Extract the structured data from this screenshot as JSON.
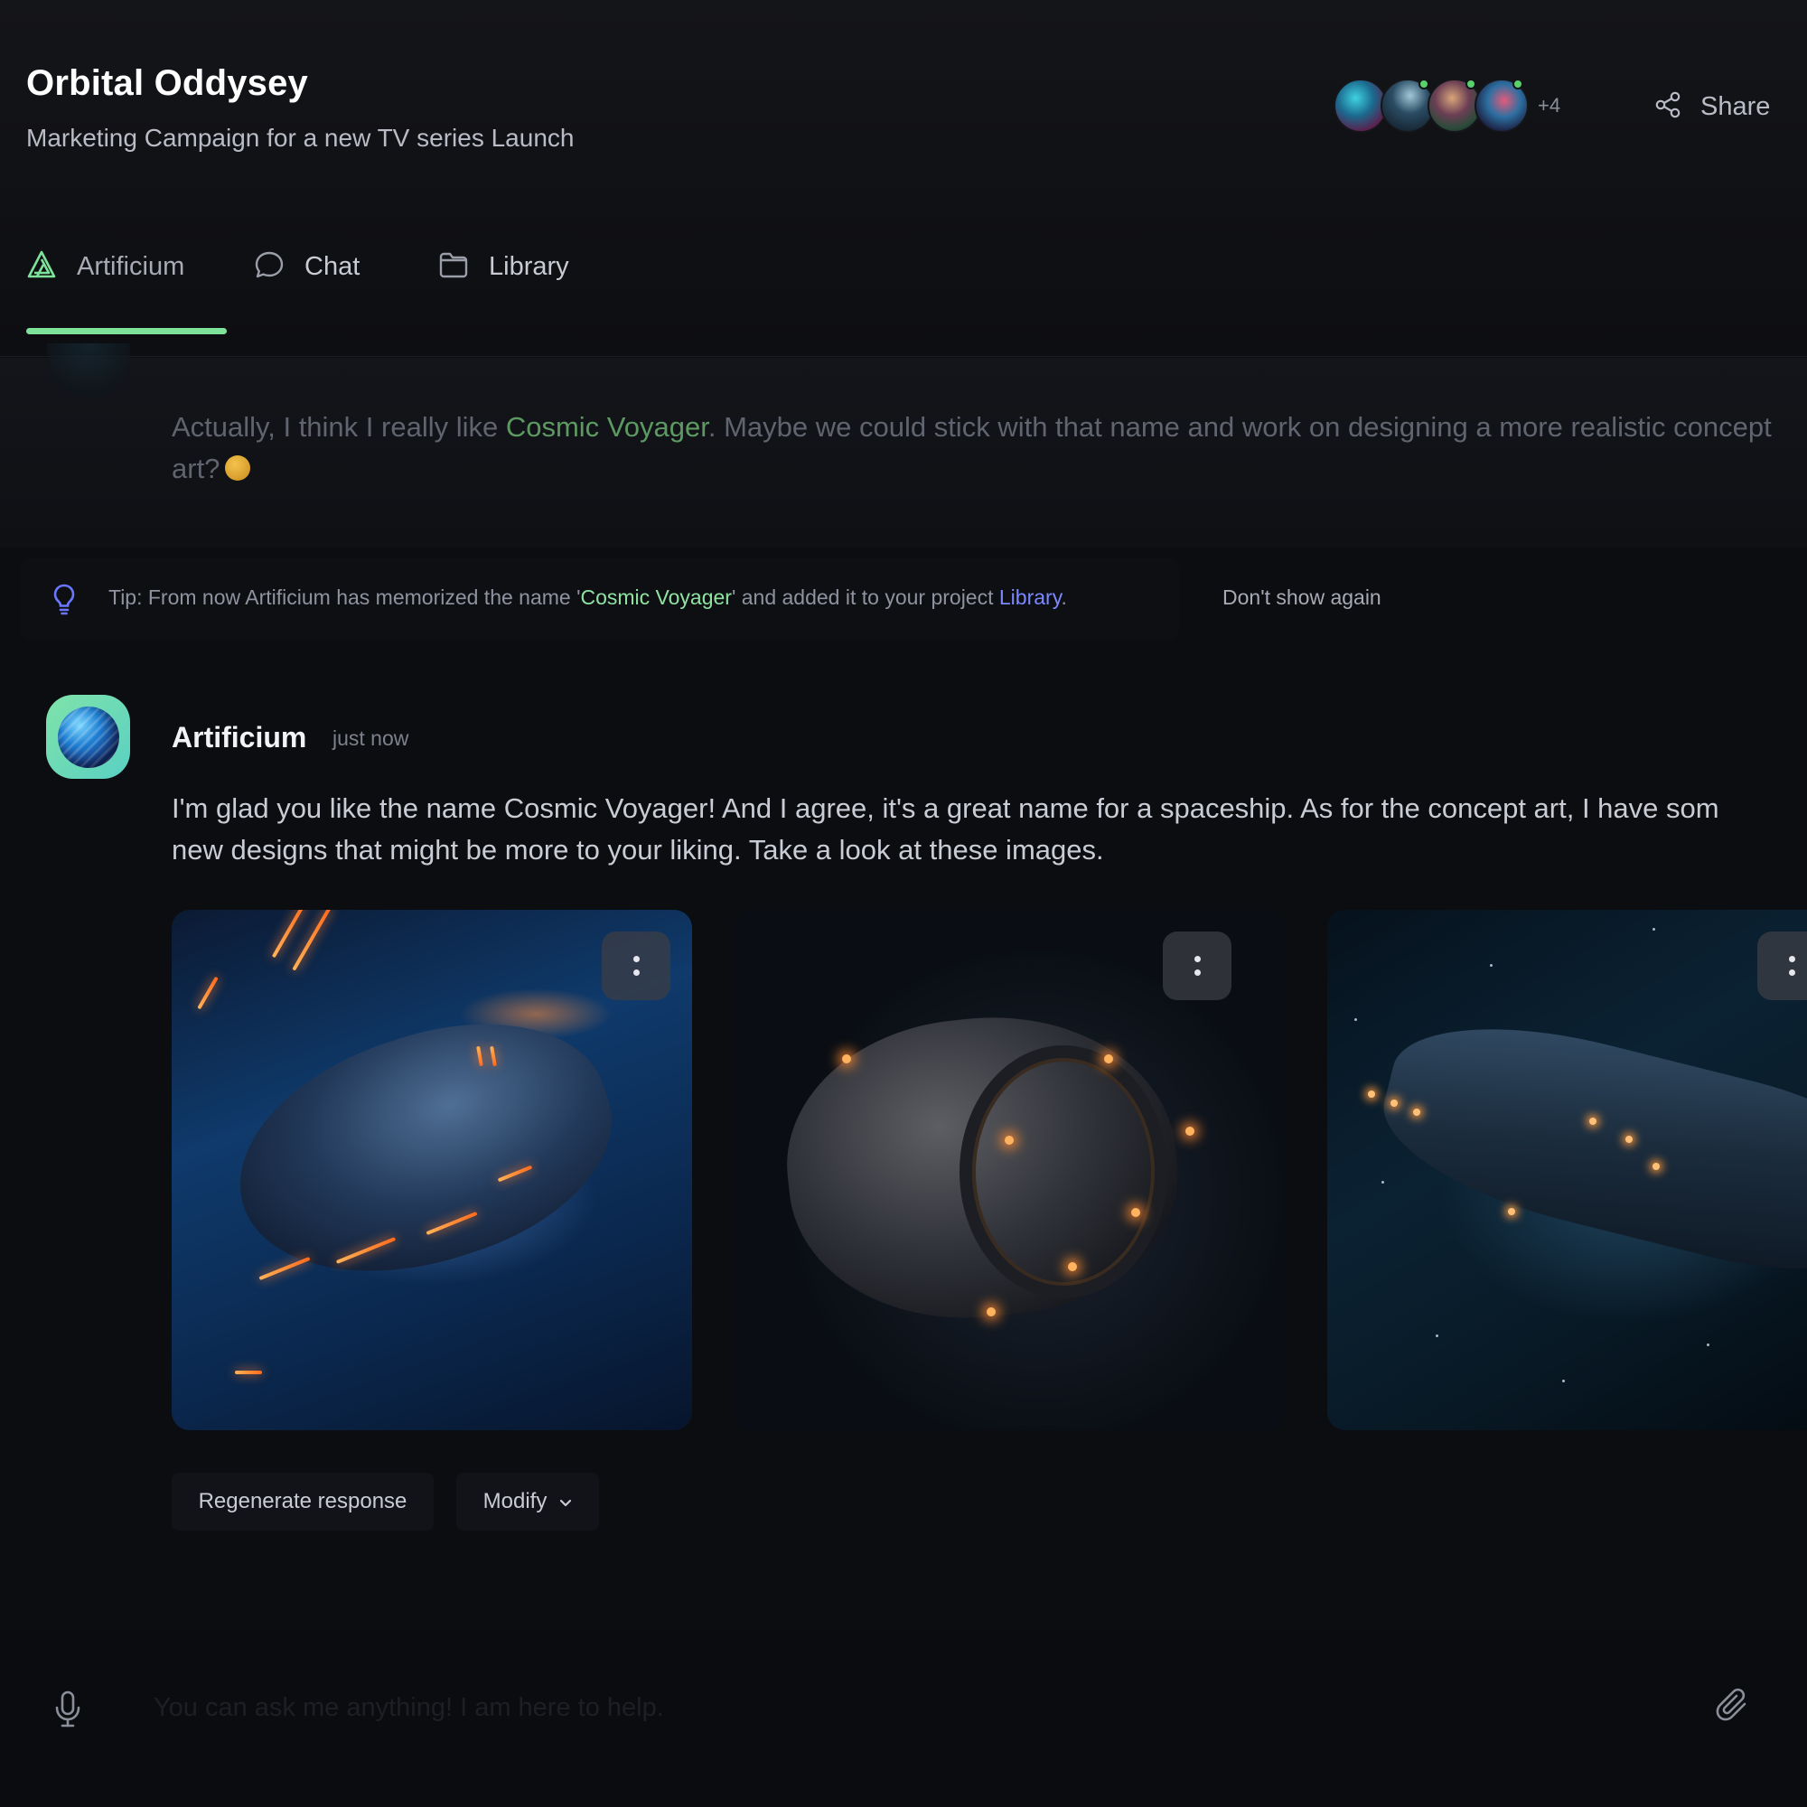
{
  "header": {
    "title": "Orbital Oddysey",
    "subtitle": "Marketing Campaign for a new TV series Launch",
    "collaborators_more": "+4",
    "share_label": "Share"
  },
  "tabs": [
    {
      "label": "Artificium",
      "icon": "artificium-logo-icon",
      "active": true
    },
    {
      "label": "Chat",
      "icon": "chat-bubble-icon",
      "active": false
    },
    {
      "label": "Library",
      "icon": "folder-icon",
      "active": false
    }
  ],
  "accent_color": "#7ee39a",
  "previous_message": {
    "text_before": "Actually, I think I really like ",
    "highlight": "Cosmic Voyager",
    "text_after": ". Maybe we could stick with that name and work on designing a more realistic concept art?"
  },
  "tip": {
    "prefix": "Tip: From now Artificium has memorized the name '",
    "name": "Cosmic Voyager",
    "middle": "' and added it to your project ",
    "link": "Library",
    "suffix": ".",
    "dismiss_label": "Don't show again"
  },
  "assistant_message": {
    "author": "Artificium",
    "time": "just now",
    "text": "I'm glad you like the name Cosmic Voyager! And I agree, it's a great name for a spaceship. As for the concept art, I have som\nnew designs that might be more to your liking. Take a look at these images."
  },
  "actions": {
    "regenerate_label": "Regenerate response",
    "modify_label": "Modify"
  },
  "composer": {
    "placeholder": "You can ask me anything! I am here to help."
  }
}
